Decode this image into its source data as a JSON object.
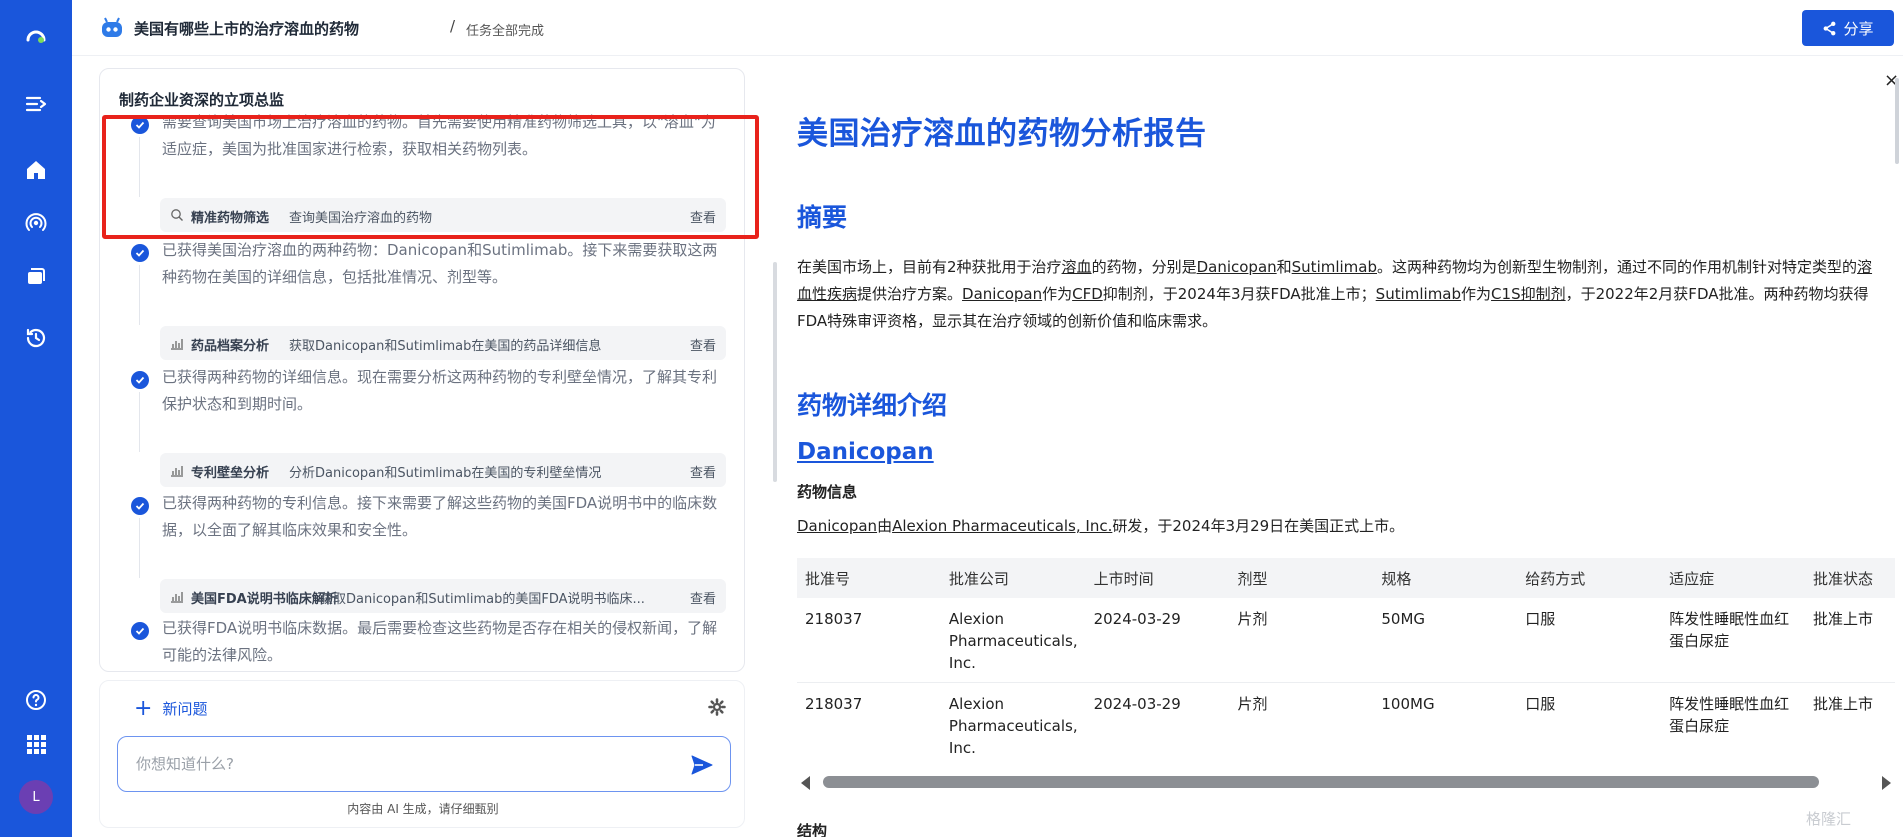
{
  "topbar": {
    "title": "美国有哪些上市的治疗溶血的药物",
    "separator": "/",
    "status": "任务全部完成",
    "share_label": "分享"
  },
  "sidebar": {
    "icons": [
      "logo-icon",
      "expand-icon",
      "home-icon",
      "broadcast-icon",
      "folders-icon",
      "history-icon",
      "help-icon",
      "apps-grid-icon"
    ],
    "avatar_letter": "L"
  },
  "panel": {
    "title": "制药企业资深的立项总监",
    "steps": [
      {
        "text": "需要查询美国市场上治疗溶血的药物。首先需要使用精准药物筛选工具，以\"溶血\"为适应症，美国为批准国家进行检索，获取相关药物列表。",
        "tool_name": "精准药物筛选",
        "tool_desc": "查询美国治疗溶血的药物",
        "tool_icon": "search-icon",
        "view_label": "查看"
      },
      {
        "text": "已获得美国治疗溶血的两种药物：Danicopan和Sutimlimab。接下来需要获取这两种药物在美国的详细信息，包括批准情况、剂型等。",
        "tool_name": "药品档案分析",
        "tool_desc": "获取Danicopan和Sutimlimab在美国的药品详细信息",
        "tool_icon": "chart-icon",
        "view_label": "查看"
      },
      {
        "text": "已获得两种药物的详细信息。现在需要分析这两种药物的专利壁垒情况，了解其专利保护状态和到期时间。",
        "tool_name": "专利壁垒分析",
        "tool_desc": "分析Danicopan和Sutimlimab在美国的专利壁垒情况",
        "tool_icon": "chart-icon",
        "view_label": "查看"
      },
      {
        "text": "已获得两种药物的专利信息。接下来需要了解这些药物的美国FDA说明书中的临床数据，以全面了解其临床效果和安全性。",
        "tool_name": "美国FDA说明书临床解析",
        "tool_desc": "获取Danicopan和Sutimlimab的美国FDA说明书临床...",
        "tool_icon": "chart-icon",
        "view_label": "查看"
      },
      {
        "text": "已获得FDA说明书临床数据。最后需要检查这些药物是否存在相关的侵权新闻，了解可能的法律风险。"
      }
    ]
  },
  "composer": {
    "new_question": "新问题",
    "placeholder": "你想知道什么?",
    "disclaimer": "内容由 AI 生成，请仔细甄别"
  },
  "report": {
    "close": "×",
    "title": "美国治疗溶血的药物分析报告",
    "summary_heading": "摘要",
    "summary_parts": [
      {
        "t": "在美国市场上，目前有2种获批用于治疗",
        "u": false
      },
      {
        "t": "溶血",
        "u": true
      },
      {
        "t": "的药物，分别是",
        "u": false
      },
      {
        "t": "Danicopan",
        "u": true
      },
      {
        "t": "和",
        "u": false
      },
      {
        "t": "Sutimlimab",
        "u": true
      },
      {
        "t": "。这两种药物均为创新型生物制剂，通过不同的作用机制针对特定类型的",
        "u": false
      },
      {
        "t": "溶血性疾病",
        "u": true
      },
      {
        "t": "提供治疗方案。",
        "u": false
      },
      {
        "t": "Danicopan",
        "u": true
      },
      {
        "t": "作为",
        "u": false
      },
      {
        "t": "CFD",
        "u": true
      },
      {
        "t": "抑制剂，于2024年3月获FDA批准上市；",
        "u": false
      },
      {
        "t": "Sutimlimab",
        "u": true
      },
      {
        "t": "作为",
        "u": false
      },
      {
        "t": "C1S抑制剂",
        "u": true
      },
      {
        "t": "，于2022年2月获FDA批准。两种药物均获得FDA特殊审评资格，显示其在治疗领域的创新价值和临床需求。",
        "u": false
      }
    ],
    "detail_heading": "药物详细介绍",
    "drug_name": "Danicopan",
    "drug_info_heading": "药物信息",
    "drug_line_parts": [
      {
        "t": "Danicopan",
        "u": true
      },
      {
        "t": "由",
        "u": false
      },
      {
        "t": "Alexion Pharmaceuticals, Inc.",
        "u": true
      },
      {
        "t": "研发，于2024年3月29日在美国正式上市。",
        "u": false
      }
    ],
    "table": {
      "headers": [
        "批准号",
        "批准公司",
        "上市时间",
        "剂型",
        "规格",
        "给药方式",
        "适应症",
        "批准状态"
      ],
      "rows": [
        [
          "218037",
          "Alexion Pharmaceuticals, Inc.",
          "2024-03-29",
          "片剂",
          "50MG",
          "口服",
          "阵发性睡眠性血红蛋白尿症",
          "批准上市"
        ],
        [
          "218037",
          "Alexion Pharmaceuticals, Inc.",
          "2024-03-29",
          "片剂",
          "100MG",
          "口服",
          "阵发性睡眠性血红蛋白尿症",
          "批准上市"
        ]
      ]
    },
    "cut_heading": "结构"
  },
  "watermark": "格隆汇"
}
